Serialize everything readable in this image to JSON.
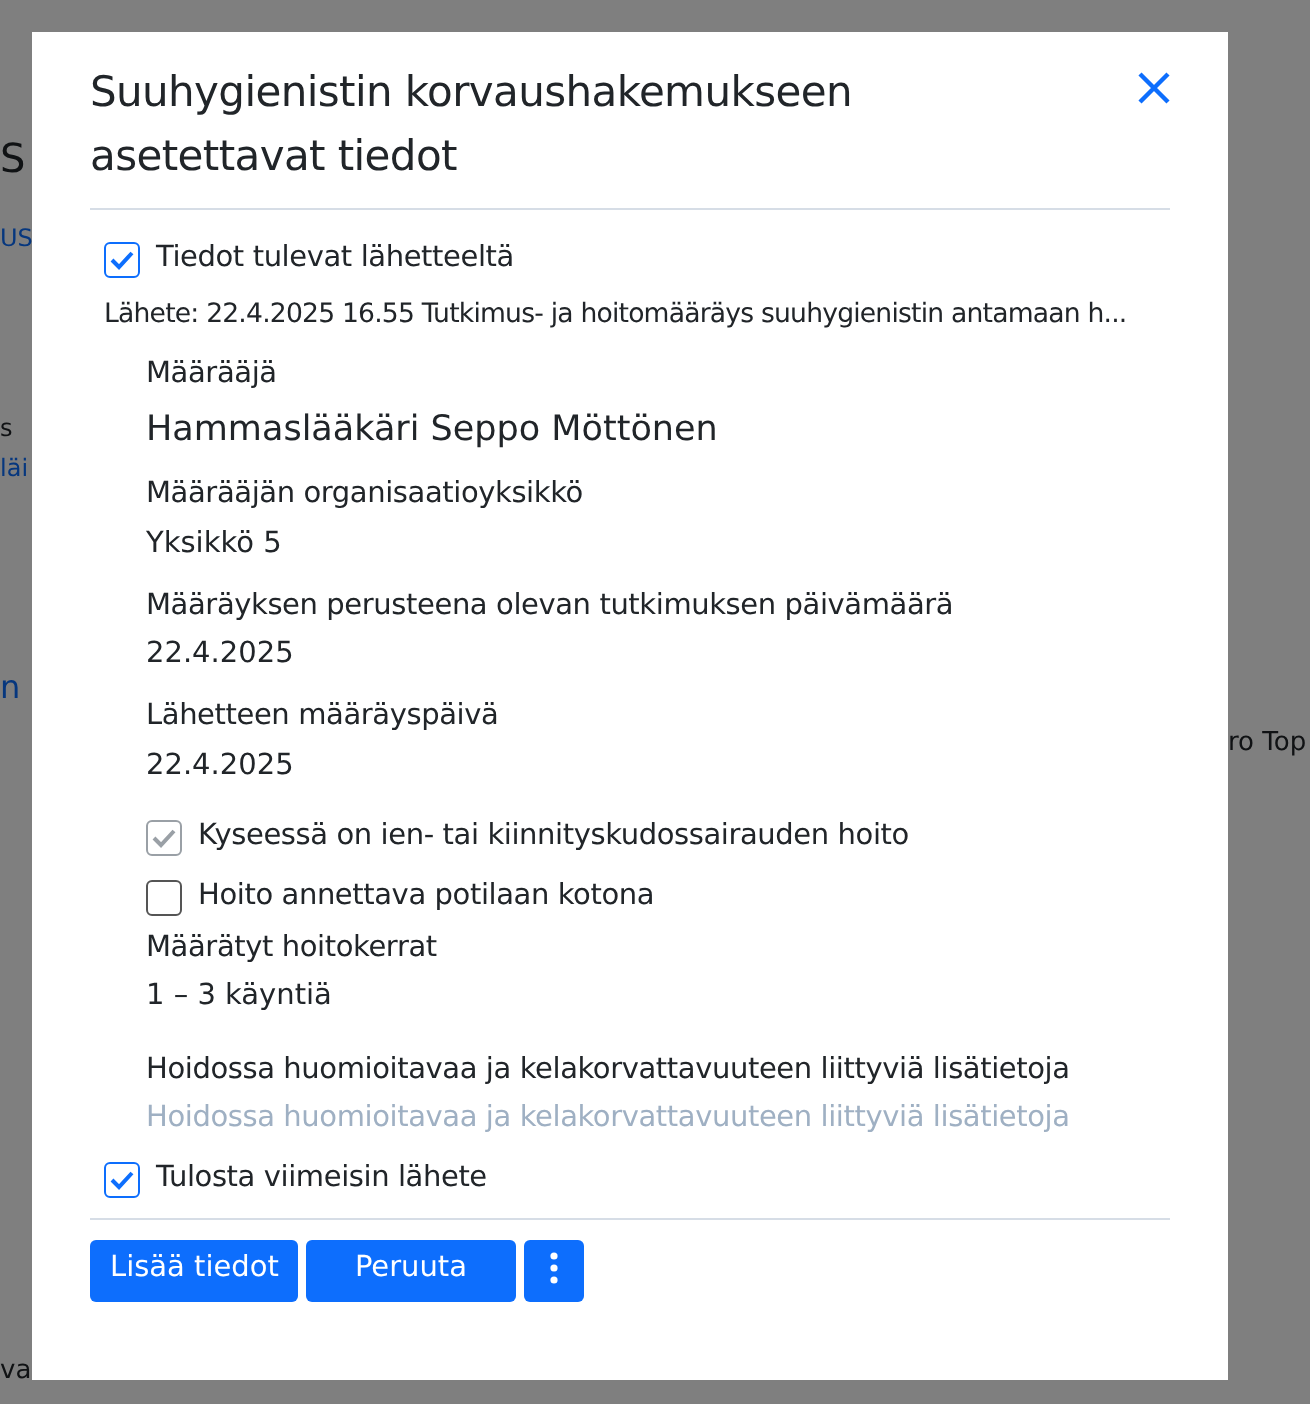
{
  "background": {
    "texts": [
      {
        "text": "S",
        "kind": "heading"
      },
      {
        "text": "US",
        "kind": "link"
      },
      {
        "text": "s",
        "kind": "plain"
      },
      {
        "text": "läi",
        "kind": "link"
      },
      {
        "text": "n",
        "kind": "link"
      },
      {
        "text": "ro Top",
        "kind": "plain"
      },
      {
        "text": "va",
        "kind": "plain"
      }
    ]
  },
  "dialog": {
    "title": "Suuhygienistin korvaushakemukseen asetettavat tiedot",
    "items": [
      {
        "kind": "checkbox",
        "label": "Tiedot tulevat lähetteeltä",
        "checked": true,
        "disabled": false
      },
      {
        "kind": "info",
        "text": "Lähete: 22.4.2025 16.55 Tutkimus- ja hoitomääräys suuhygienistin antamaan h..."
      },
      {
        "kind": "field",
        "label": "Määrääjä",
        "value": "Hammaslääkäri Seppo Möttönen",
        "emphasis": true
      },
      {
        "kind": "field",
        "label": "Määrääjän organisaatioyksikkö",
        "value": "Yksikkö 5",
        "emphasis": false
      },
      {
        "kind": "field",
        "label": "Määräyksen perusteena olevan tutkimuksen päivämäärä",
        "value": "22.4.2025",
        "emphasis": false
      },
      {
        "kind": "field",
        "label": "Lähetteen määräyspäivä",
        "value": "22.4.2025",
        "emphasis": false
      },
      {
        "kind": "subcheckbox",
        "label": "Kyseessä on ien- tai kiinnityskudossairauden hoito",
        "checked": true,
        "disabled": true
      },
      {
        "kind": "subcheckbox",
        "label": "Hoito annettava potilaan kotona",
        "checked": false,
        "disabled": false
      },
      {
        "kind": "field",
        "label": "Määrätyt hoitokerrat",
        "value": "1 – 3 käyntiä",
        "emphasis": false
      },
      {
        "kind": "textarea",
        "label": "Hoidossa huomioitavaa ja kelakorvattavuuteen liittyviä lisätietoja",
        "placeholder": "Hoidossa huomioitavaa ja kelakorvattavuuteen liittyviä lisätietoja"
      },
      {
        "kind": "checkbox",
        "label": "Tulosta viimeisin lähete",
        "checked": true,
        "disabled": false
      }
    ],
    "buttons": [
      {
        "label": "Lisää tiedot",
        "kind": "text"
      },
      {
        "label": "Peruuta",
        "kind": "wide"
      },
      {
        "kind": "more"
      }
    ]
  }
}
